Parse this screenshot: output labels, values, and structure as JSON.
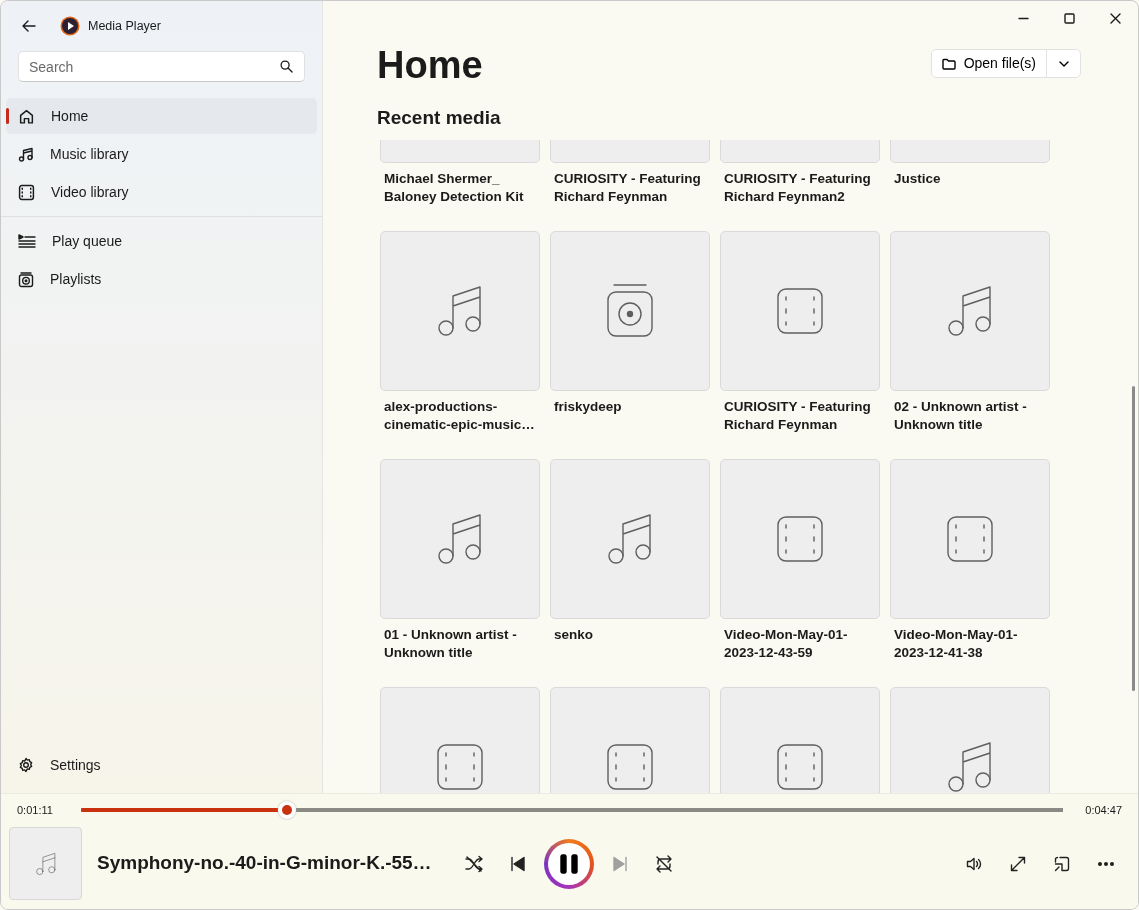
{
  "window": {
    "title": "Media Player"
  },
  "search": {
    "placeholder": "Search"
  },
  "sidebar": {
    "sections": [
      [
        {
          "label": "Home",
          "selected": true
        },
        {
          "label": "Music library",
          "selected": false
        },
        {
          "label": "Video library",
          "selected": false
        }
      ],
      [
        {
          "label": "Play queue",
          "selected": false
        },
        {
          "label": "Playlists",
          "selected": false
        }
      ]
    ],
    "settings": "Settings"
  },
  "page": {
    "title": "Home",
    "open_button": "Open file(s)",
    "section_title": "Recent media"
  },
  "media": [
    {
      "title": "Michael Shermer_ Baloney Detection Kit"
    },
    {
      "title": "CURIOSITY - Featuring Richard Feynman"
    },
    {
      "title": "CURIOSITY - Featuring Richard Feynman2"
    },
    {
      "title": "Justice"
    },
    {
      "title": "alex-productions-cinematic-epic-music…",
      "kind": "music"
    },
    {
      "title": "friskydeep",
      "kind": "playlist"
    },
    {
      "title": "CURIOSITY - Featuring Richard Feynman",
      "kind": "video"
    },
    {
      "title": "02 - Unknown artist - Unknown title",
      "kind": "music"
    },
    {
      "title": "01 - Unknown artist - Unknown title",
      "kind": "music"
    },
    {
      "title": "senko",
      "kind": "music"
    },
    {
      "title": "Video-Mon-May-01-2023-12-43-59",
      "kind": "video"
    },
    {
      "title": "Video-Mon-May-01-2023-12-41-38",
      "kind": "video"
    },
    {
      "kind": "video"
    },
    {
      "kind": "video"
    },
    {
      "kind": "video"
    },
    {
      "kind": "music"
    }
  ],
  "player": {
    "elapsed": "0:01:11",
    "total": "0:04:47",
    "level": 0.21,
    "title": "Symphony-no.-40-in-G-minor-K.-55…",
    "playing": true,
    "shuffle_on": false,
    "repeat_on": false,
    "next_disabled": true
  }
}
